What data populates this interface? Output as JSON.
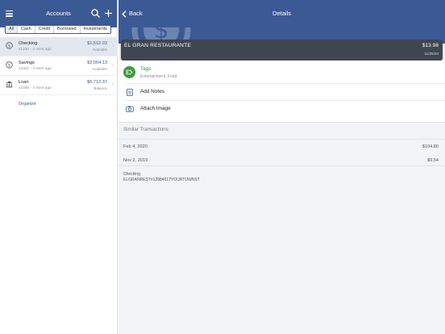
{
  "left": {
    "title": "Accounts",
    "segments": [
      "All",
      "Cash",
      "Credit",
      "Borrowed",
      "Investments"
    ],
    "accounts": [
      {
        "name": "Checking",
        "sub": "x1234 - 4 mins ago",
        "amount": "$1,512.03",
        "kind": "Available",
        "icon": "dollar-circle-icon"
      },
      {
        "name": "Savings",
        "sub": "x4321 - 4 mins ago",
        "amount": "$2,564.13",
        "kind": "Available",
        "icon": "dollar-circle-icon"
      },
      {
        "name": "Loan",
        "sub": "x2345 - 4 mins ago",
        "amount": "$6,712.37",
        "kind": "Balance",
        "icon": "bank-icon"
      }
    ],
    "organize": "Organize"
  },
  "right": {
    "back": "Back",
    "title": "Details",
    "transaction": {
      "payee": "EL GRAN RESTAURANTE",
      "amount": "$13.98",
      "date": "11/25/20"
    },
    "tags": {
      "label": "Tags",
      "value": "Entertainment, Food"
    },
    "notes_label": "Add Notes",
    "attach_label": "Attach Image",
    "similar_header": "Similar Transactions",
    "similar": [
      {
        "date": "Feb 4, 2020",
        "amount": "$104.80"
      },
      {
        "date": "Nov 2, 2019",
        "amount": "$9.54"
      }
    ],
    "meta": {
      "account": "Checking",
      "description": "ELGRANREST#12884617YOURTOWNST"
    }
  },
  "colors": {
    "brand": "#3b5a95",
    "tag_green": "#3c9a3f",
    "card_dark": "#3f4650"
  }
}
